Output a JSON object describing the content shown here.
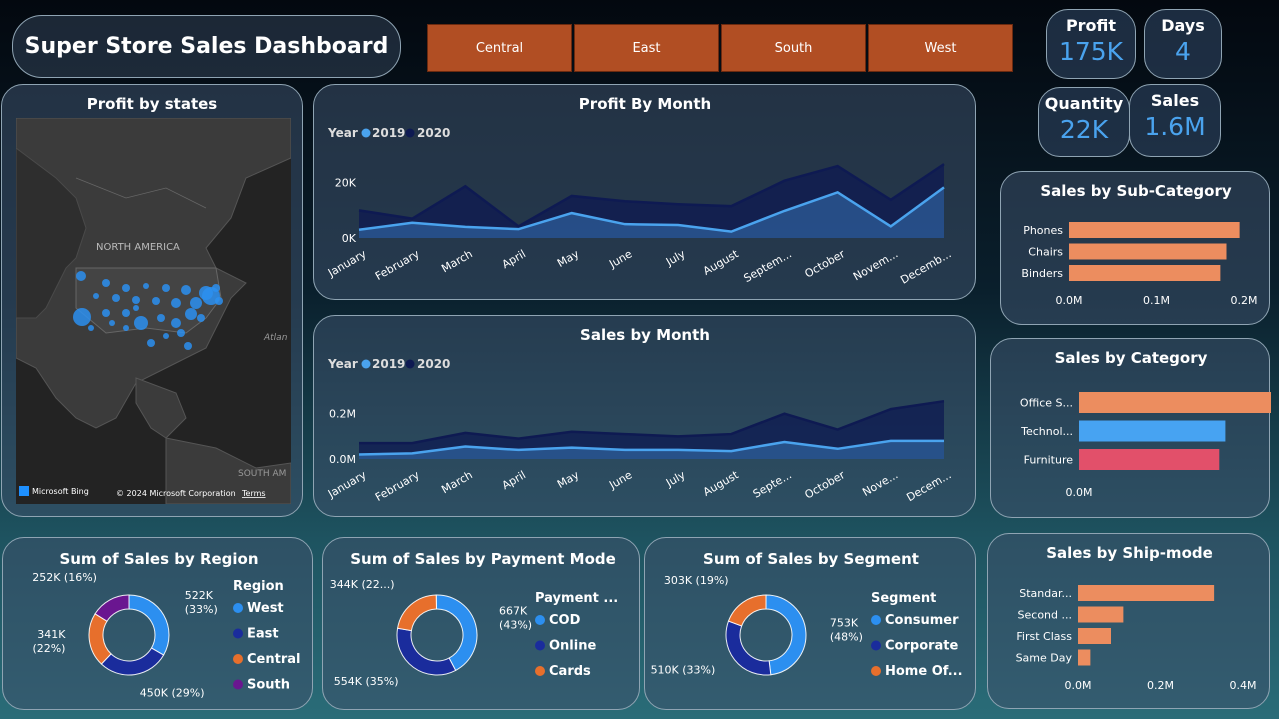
{
  "header": {
    "title": "Super Store Sales Dashboard"
  },
  "region_buttons": [
    "Central",
    "East",
    "South",
    "West"
  ],
  "kpis": {
    "profit": {
      "label": "Profit",
      "value": "175K"
    },
    "days": {
      "label": "Days",
      "value": "4"
    },
    "quantity": {
      "label": "Quantity",
      "value": "22K"
    },
    "sales": {
      "label": "Sales",
      "value": "1.6M"
    }
  },
  "map": {
    "title": "Profit by states",
    "label_na": "NORTH AMERICA",
    "label_sa": "SOUTH AM",
    "label_atl": "Atlan",
    "bing": "Microsoft Bing",
    "copyright": "© 2024 Microsoft Corporation",
    "terms": "Terms"
  },
  "legend": {
    "year_label": "Year",
    "y2019": "2019",
    "y2020": "2020"
  },
  "colors": {
    "y2019": "#4aa3ee",
    "y2020": "#0e1a52",
    "west": "#2c8ff0",
    "east": "#1a2c9c",
    "central": "#e76f2c",
    "south": "#6a1690",
    "bar_orange": "#ec8d5f",
    "bar_blue": "#47a3f2",
    "bar_red": "#e2506a"
  },
  "chart_data": [
    {
      "type": "area",
      "title": "Profit By Month",
      "categories": [
        "January",
        "February",
        "March",
        "April",
        "May",
        "June",
        "July",
        "August",
        "Septem...",
        "October",
        "Novem...",
        "Decemb..."
      ],
      "yticks": [
        "0K",
        "20K"
      ],
      "ylim": [
        0,
        30000
      ],
      "series": [
        {
          "name": "2019",
          "values": [
            3000,
            5500,
            4000,
            3200,
            9000,
            5000,
            4700,
            2300,
            9800,
            16500,
            4200,
            18300
          ]
        },
        {
          "name": "2020",
          "values": [
            10000,
            7000,
            18700,
            4200,
            15200,
            13300,
            12200,
            11500,
            20700,
            26000,
            13800,
            26700
          ]
        }
      ]
    },
    {
      "type": "area",
      "title": "Sales by Month",
      "categories": [
        "January",
        "February",
        "March",
        "April",
        "May",
        "June",
        "July",
        "August",
        "Septe...",
        "October",
        "Nove...",
        "Decem..."
      ],
      "yticks": [
        "0.0M",
        "0.2M"
      ],
      "ylim": [
        0,
        0.3
      ],
      "series": [
        {
          "name": "2019",
          "values": [
            0.02,
            0.025,
            0.055,
            0.04,
            0.05,
            0.04,
            0.04,
            0.035,
            0.075,
            0.045,
            0.08,
            0.08
          ]
        },
        {
          "name": "2020",
          "values": [
            0.07,
            0.07,
            0.115,
            0.09,
            0.12,
            0.11,
            0.1,
            0.11,
            0.2,
            0.13,
            0.22,
            0.255
          ]
        }
      ]
    },
    {
      "type": "bar",
      "title": "Sales by Sub-Category",
      "categories": [
        "Phones",
        "Chairs",
        "Binders"
      ],
      "values": [
        0.195,
        0.18,
        0.173
      ],
      "xticks": [
        "0.0M",
        "0.1M",
        "0.2M"
      ],
      "xlim": [
        0,
        0.2
      ]
    },
    {
      "type": "bar",
      "title": "Sales by Category",
      "categories": [
        "Office S...",
        "Technol...",
        "Furniture"
      ],
      "values": [
        0.66,
        0.48,
        0.46
      ],
      "xticks": [
        "0.0M",
        "0.5M"
      ],
      "xlim": [
        0,
        1.0
      ]
    },
    {
      "type": "bar",
      "title": "Sales by Ship-mode",
      "categories": [
        "Standar...",
        "Second ...",
        "First Class",
        "Same Day"
      ],
      "values": [
        0.33,
        0.11,
        0.08,
        0.03
      ],
      "xticks": [
        "0.0M",
        "0.2M",
        "0.4M"
      ],
      "xlim": [
        0,
        0.4
      ]
    },
    {
      "type": "pie",
      "title": "Sum of Sales by Region",
      "legend_title": "Region",
      "slices": [
        {
          "name": "West",
          "value": 522,
          "label": "522K\n(33%)",
          "color": "#2c8ff0"
        },
        {
          "name": "East",
          "value": 450,
          "label": "450K (29%)",
          "color": "#1a2c9c"
        },
        {
          "name": "Central",
          "value": 341,
          "label": "341K\n(22%)",
          "color": "#e76f2c"
        },
        {
          "name": "South",
          "value": 252,
          "label": "252K (16%)",
          "color": "#6a1690"
        }
      ]
    },
    {
      "type": "pie",
      "title": "Sum of Sales by Payment Mode",
      "legend_title": "Payment ...",
      "slices": [
        {
          "name": "COD",
          "value": 667,
          "label": "667K\n(43%)",
          "color": "#2c8ff0"
        },
        {
          "name": "Online",
          "value": 554,
          "label": "554K (35%)",
          "color": "#1a2c9c"
        },
        {
          "name": "Cards",
          "value": 344,
          "label": "344K (22...)",
          "color": "#e76f2c"
        }
      ]
    },
    {
      "type": "pie",
      "title": "Sum of Sales by Segment",
      "legend_title": "Segment",
      "slices": [
        {
          "name": "Consumer",
          "value": 753,
          "label": "753K\n(48%)",
          "color": "#2c8ff0"
        },
        {
          "name": "Corporate",
          "value": 510,
          "label": "510K (33%)",
          "color": "#1a2c9c"
        },
        {
          "name": "Home Of...",
          "value": 303,
          "label": "303K (19%)",
          "color": "#e76f2c"
        }
      ]
    }
  ]
}
